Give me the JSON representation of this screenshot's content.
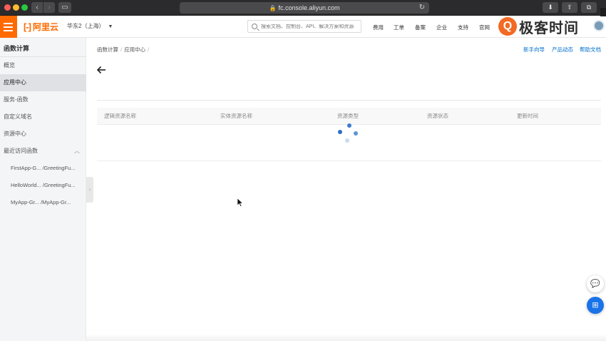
{
  "browser": {
    "url": "fc.console.aliyun.com",
    "back_icon": "chevron-left-icon",
    "forward_icon": "chevron-right-icon"
  },
  "topbar": {
    "logo_mark": "[-]",
    "logo_text": "阿里云",
    "region": "华东2（上海）",
    "search_placeholder": "搜索文档、控制台、API、解决方案和资源",
    "nav": [
      "费用",
      "工单",
      "备案",
      "企业",
      "支持",
      "官网"
    ],
    "watermark_q": "Q",
    "watermark": "极客时间",
    "accent_color": "#ff6a00"
  },
  "sidebar": {
    "title": "函数计算",
    "items": [
      {
        "label": "概览",
        "active": false
      },
      {
        "label": "应用中心",
        "active": true
      },
      {
        "label": "服务-函数",
        "active": false
      },
      {
        "label": "自定义域名",
        "active": false
      },
      {
        "label": "资源中心",
        "active": false
      },
      {
        "label": "最近访问函数",
        "active": false
      }
    ],
    "recent": [
      "FirstApp-G... /GreetingFu...",
      "HelloWorld... /GreetingFu...",
      "MyApp-Gr... /MyApp-Gr..."
    ]
  },
  "main": {
    "breadcrumb": [
      "函数计算",
      "应用中心"
    ],
    "links": [
      "新手向导",
      "产品动态",
      "帮助文档"
    ],
    "table_headers": [
      "逻辑资源名称",
      "实体资源名称",
      "资源类型",
      "资源状态",
      "更新时间"
    ],
    "loading": true
  }
}
